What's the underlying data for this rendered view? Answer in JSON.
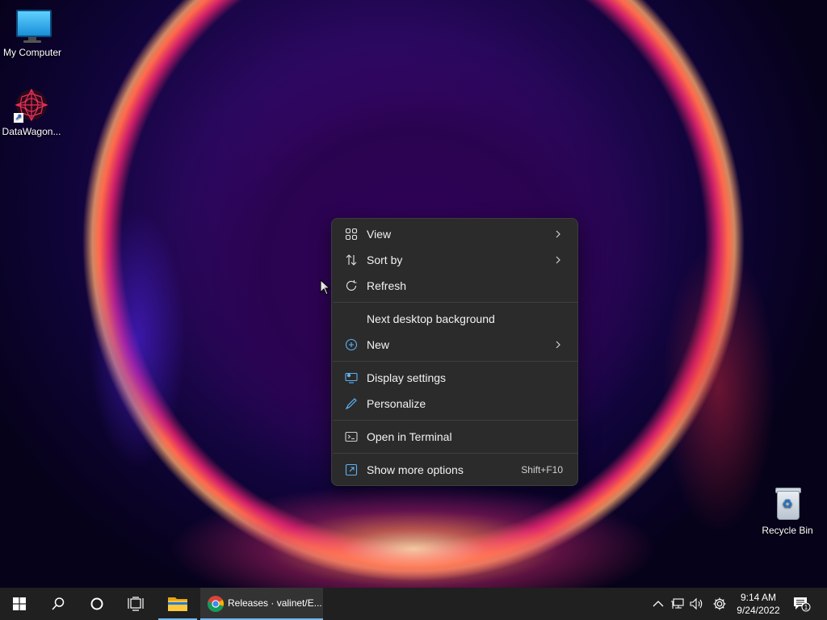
{
  "desktop": {
    "icons": [
      {
        "label": "My Computer",
        "icon": "monitor-icon"
      },
      {
        "label": "DataWagon...",
        "icon": "datawagon-shortcut-icon"
      },
      {
        "label": "Recycle Bin",
        "icon": "recycle-bin-icon"
      }
    ]
  },
  "context_menu": {
    "items": [
      {
        "label": "View",
        "icon": "grid-icon",
        "submenu": true
      },
      {
        "label": "Sort by",
        "icon": "sort-arrows-icon",
        "submenu": true
      },
      {
        "label": "Refresh",
        "icon": "refresh-icon",
        "submenu": false
      },
      {
        "label": "Next desktop background",
        "icon": "",
        "submenu": false
      },
      {
        "label": "New",
        "icon": "add-circle-icon",
        "submenu": true
      },
      {
        "label": "Display settings",
        "icon": "display-settings-icon",
        "submenu": false
      },
      {
        "label": "Personalize",
        "icon": "pen-icon",
        "submenu": false
      },
      {
        "label": "Open in Terminal",
        "icon": "terminal-icon",
        "submenu": false
      },
      {
        "label": "Show more options",
        "icon": "open-external-icon",
        "shortcut": "Shift+F10"
      }
    ]
  },
  "taskbar": {
    "start_icon": "windows-logo-icon",
    "search_icon": "search-icon",
    "cortana_icon": "cortana-ring-icon",
    "task_view_icon": "task-view-icon",
    "pinned": [
      {
        "name": "File Explorer",
        "icon": "folder-icon"
      }
    ],
    "active_window": {
      "label": "Releases · valinet/E...",
      "icon": "chrome-icon"
    },
    "tray": {
      "icons": [
        "chevron-up-icon",
        "network-icon",
        "volume-icon",
        "settings-gear-icon"
      ],
      "time": "9:14 AM",
      "date": "9/24/2022",
      "notification_count": "1"
    }
  },
  "colors": {
    "menu_bg": "#2b2b2b",
    "taskbar_bg": "#202020",
    "accent": "#76b9ed"
  }
}
